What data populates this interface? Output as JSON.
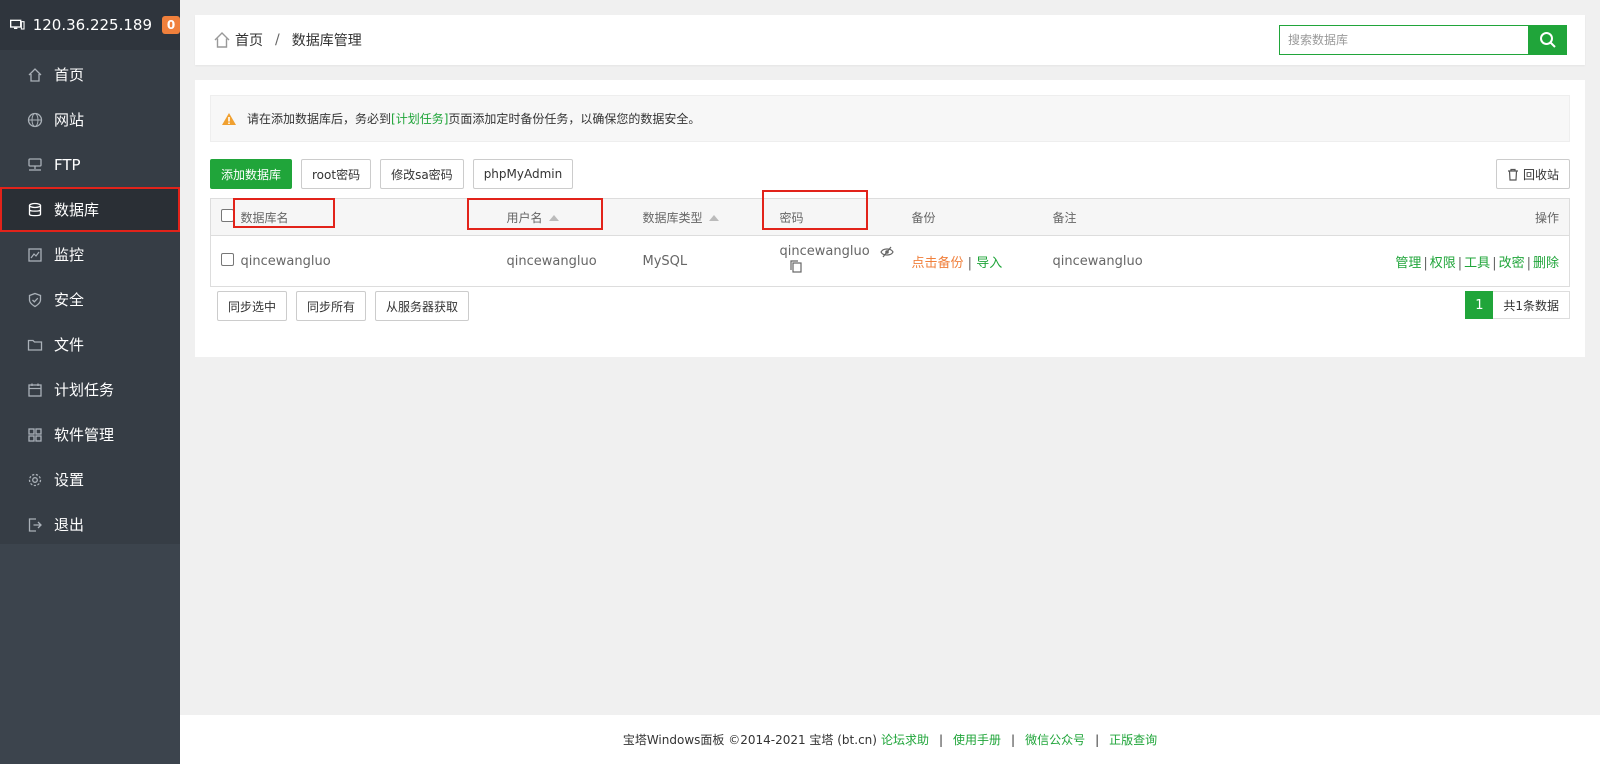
{
  "sidebar": {
    "ip": "120.36.225.189",
    "badge": "0",
    "items": [
      {
        "label": "首页",
        "icon": "home-icon"
      },
      {
        "label": "网站",
        "icon": "globe-icon"
      },
      {
        "label": "FTP",
        "icon": "ftp-icon"
      },
      {
        "label": "数据库",
        "icon": "database-icon",
        "active": true
      },
      {
        "label": "监控",
        "icon": "monitor-icon"
      },
      {
        "label": "安全",
        "icon": "shield-icon"
      },
      {
        "label": "文件",
        "icon": "folder-icon"
      },
      {
        "label": "计划任务",
        "icon": "calendar-icon"
      },
      {
        "label": "软件管理",
        "icon": "apps-icon"
      },
      {
        "label": "设置",
        "icon": "gear-icon"
      },
      {
        "label": "退出",
        "icon": "logout-icon"
      }
    ]
  },
  "breadcrumb": {
    "home": "首页",
    "sep": "/",
    "current": "数据库管理"
  },
  "search": {
    "placeholder": "搜索数据库"
  },
  "notice": {
    "before": "请在添加数据库后，务必到",
    "link": "[计划任务]",
    "after": "页面添加定时备份任务，以确保您的数据安全。"
  },
  "toolbar": {
    "add": "添加数据库",
    "root": "root密码",
    "sa": "修改sa密码",
    "pma": "phpMyAdmin",
    "recycle": "回收站"
  },
  "table": {
    "headers": {
      "name": "数据库名",
      "user": "用户名",
      "type": "数据库类型",
      "password": "密码",
      "backup": "备份",
      "note": "备注",
      "ops": "操作"
    },
    "rows": [
      {
        "name": "qincewangluo",
        "user": "qincewangluo",
        "type": "MySQL",
        "password": "qincewangluo",
        "backup_click": "点击备份",
        "backup_sep": "|",
        "import": "导入",
        "note": "qincewangluo",
        "ops": [
          "管理",
          "权限",
          "工具",
          "改密",
          "删除"
        ]
      }
    ]
  },
  "bottom": {
    "sync_sel": "同步选中",
    "sync_all": "同步所有",
    "fetch": "从服务器获取",
    "page": "1",
    "total": "共1条数据"
  },
  "footer": {
    "copy": "宝塔Windows面板 ©2014-2021 宝塔 (bt.cn)",
    "links": [
      "论坛求助",
      "使用手册",
      "微信公众号",
      "正版查询"
    ],
    "pipe": "|"
  },
  "colors": {
    "green": "#20a53a",
    "orange": "#f0803c",
    "sidebar": "#3c444d",
    "highlight": "#e2231a"
  }
}
